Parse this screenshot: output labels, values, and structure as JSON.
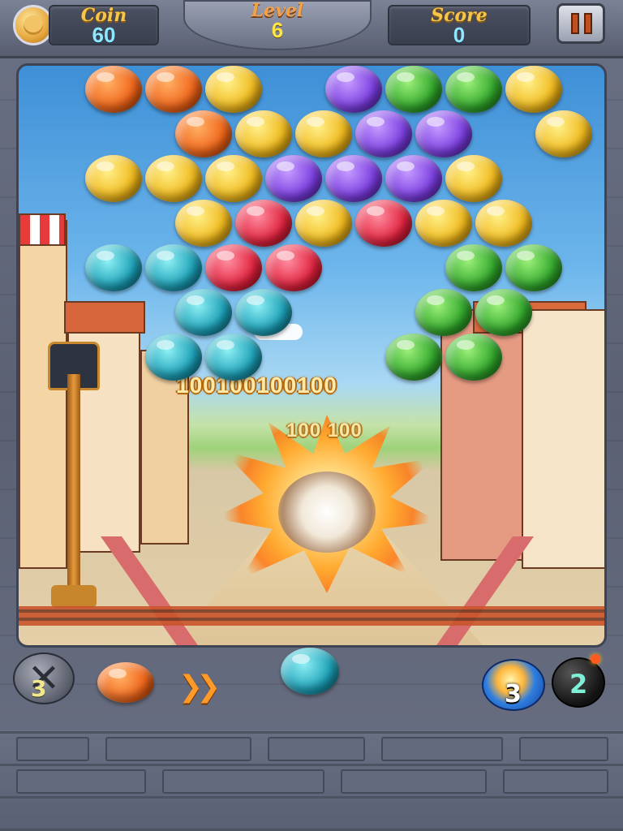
{
  "hud": {
    "coin_label": "Coin",
    "coin_value": "60",
    "level_label": "Level",
    "level_value": "6",
    "score_label": "Score",
    "score_value": "0"
  },
  "effects": {
    "points_line_1": "100100100100",
    "points_line_2": "100 100"
  },
  "controls": {
    "swap_count": "3",
    "special_count": "3",
    "bomb_count": "2"
  },
  "bubble_colors": {
    "orange": "#f06418",
    "yellow": "#f0b81a",
    "purple": "#7a3ce0",
    "green": "#2fa52a",
    "red": "#e0203c",
    "cyan": "#1a9fb6"
  },
  "grid": [
    [
      "orange",
      "orange",
      "yellow",
      null,
      "purple",
      "green",
      "green",
      "yellow"
    ],
    [
      null,
      "orange",
      "yellow",
      "yellow",
      "purple",
      "purple",
      null,
      "yellow"
    ],
    [
      "yellow",
      "yellow",
      "yellow",
      "purple",
      "purple",
      "purple",
      "yellow",
      null
    ],
    [
      null,
      "yellow",
      "red",
      "yellow",
      "red",
      "yellow",
      "yellow",
      null
    ],
    [
      "cyan",
      "cyan",
      "red",
      "red",
      null,
      null,
      "green",
      "green"
    ],
    [
      null,
      "cyan",
      "cyan",
      null,
      null,
      "green",
      "green",
      null
    ],
    [
      null,
      "cyan",
      "cyan",
      null,
      null,
      "green",
      "green",
      null
    ]
  ],
  "next_bubble": "orange",
  "shooter_bubble": "cyan"
}
